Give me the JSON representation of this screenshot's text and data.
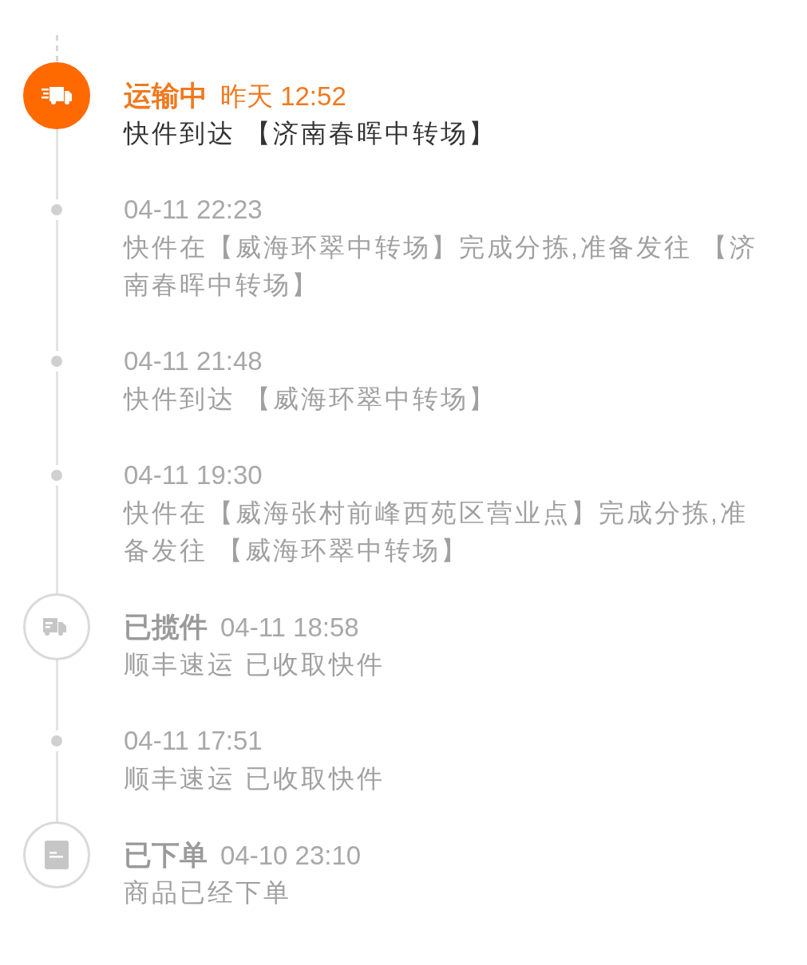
{
  "events": [
    {
      "kind": "shipping",
      "active": true,
      "status": "运输中",
      "time": "昨天 12:52",
      "detail": "快件到达 【济南春晖中转场】"
    },
    {
      "kind": "step",
      "active": false,
      "time": "04-11 22:23",
      "detail": "快件在【威海环翠中转场】完成分拣,准备发往 【济南春晖中转场】"
    },
    {
      "kind": "step",
      "active": false,
      "time": "04-11 21:48",
      "detail": "快件到达 【威海环翠中转场】"
    },
    {
      "kind": "step",
      "active": false,
      "time": "04-11 19:30",
      "detail": "快件在【威海张村前峰西苑区营业点】完成分拣,准备发往 【威海环翠中转场】"
    },
    {
      "kind": "pickup",
      "active": false,
      "status": "已揽件",
      "time": "04-11 18:58",
      "detail": "顺丰速运 已收取快件"
    },
    {
      "kind": "step",
      "active": false,
      "time": "04-11 17:51",
      "detail": "顺丰速运 已收取快件"
    },
    {
      "kind": "order",
      "active": false,
      "status": "已下单",
      "time": "04-10 23:10",
      "detail": "商品已经下单"
    }
  ]
}
